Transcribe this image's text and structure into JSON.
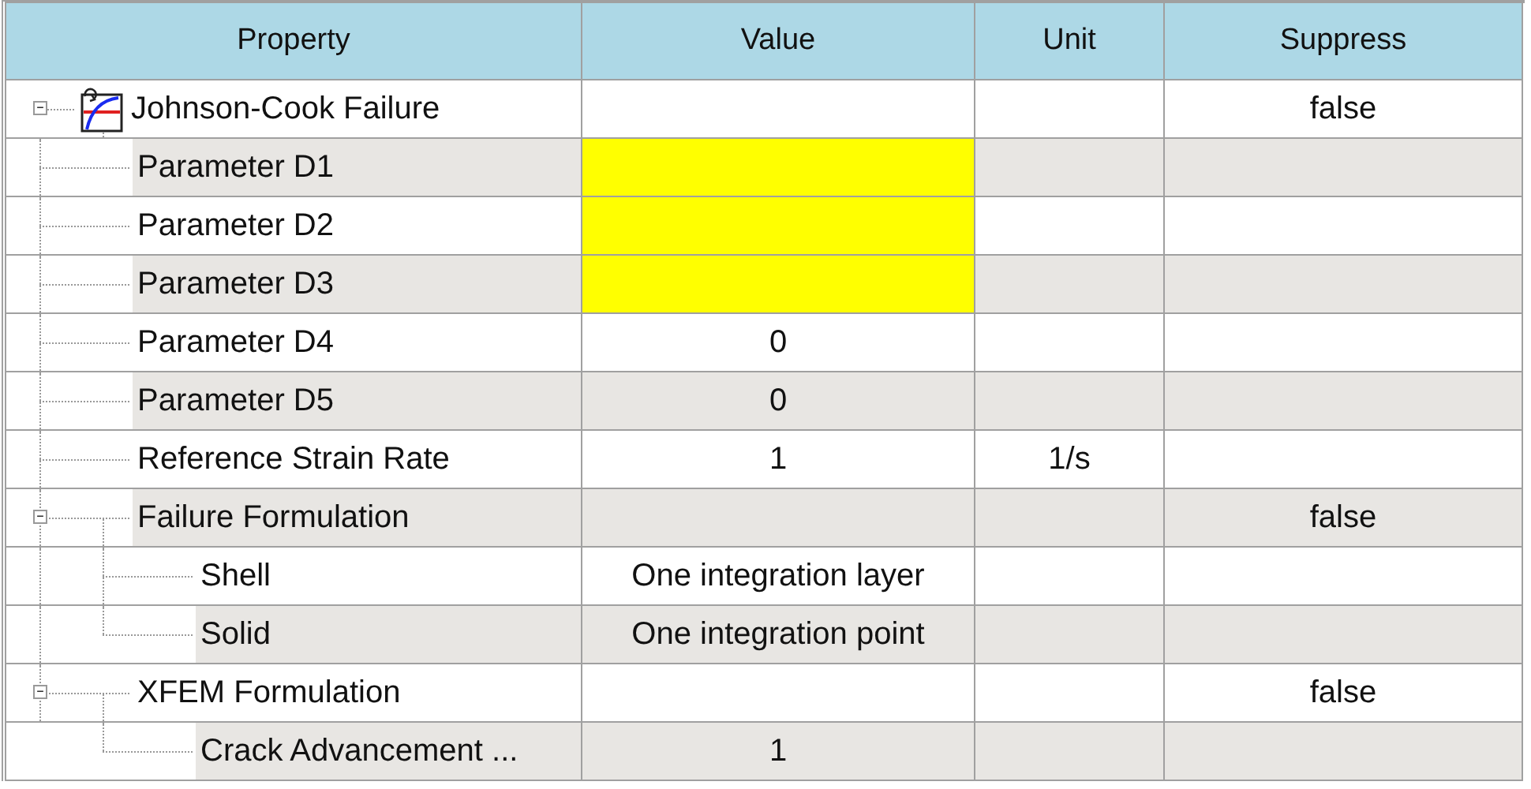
{
  "columns": [
    "Property",
    "Value",
    "Unit",
    "Suppress"
  ],
  "tree": [
    {
      "label": "Johnson-Cook Failure",
      "expanded": true,
      "highlighted": false,
      "suppress": "false",
      "children": [
        {
          "label": "Parameter D1",
          "highlighted": true
        },
        {
          "label": "Parameter D2",
          "highlighted": true
        },
        {
          "label": "Parameter D3",
          "highlighted": true
        },
        {
          "label": "Parameter D4",
          "highlighted": false,
          "value": "0"
        },
        {
          "label": "Parameter D5",
          "highlighted": false,
          "value": "0"
        },
        {
          "label": "Reference Strain Rate",
          "highlighted": false,
          "value": "1",
          "unit": "1/s"
        },
        {
          "label": "Failure Formulation",
          "expanded": true,
          "highlighted": false,
          "suppress": "false",
          "children": [
            {
              "label": "Shell",
              "highlighted": false,
              "value": "One integration layer"
            },
            {
              "label": "Solid",
              "highlighted": false,
              "value": "One integration point"
            }
          ]
        },
        {
          "label": "XFEM Formulation",
          "expanded": true,
          "highlighted": false,
          "suppress": "false",
          "children": [
            {
              "label": "Crack Advancement ...",
              "highlighted": false,
              "value": "1"
            }
          ]
        }
      ]
    }
  ]
}
